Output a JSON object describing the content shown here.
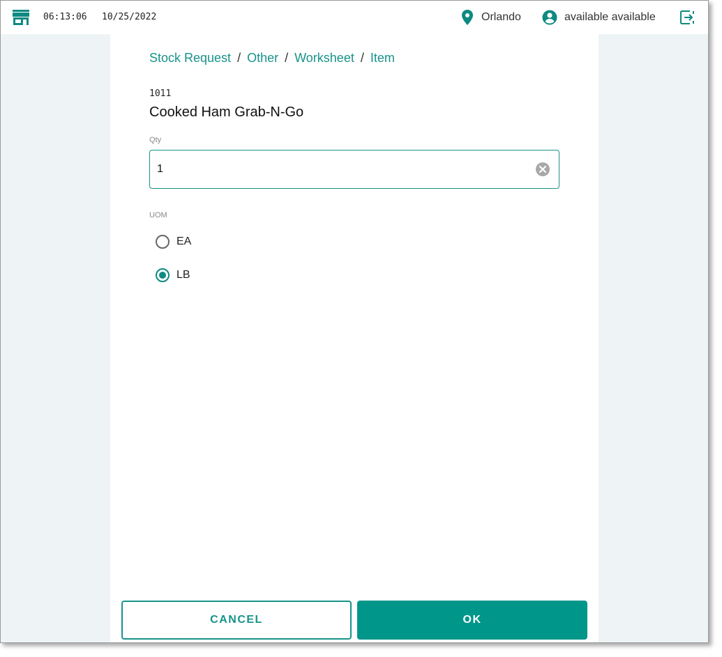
{
  "header": {
    "store_icon": "storefront-icon",
    "time": "06:13:06",
    "date": "10/25/2022",
    "location_icon": "map-pin-icon",
    "location": "Orlando",
    "user_icon": "account-circle-icon",
    "user": "available available",
    "logout_icon": "logout-icon"
  },
  "breadcrumb": {
    "items": [
      "Stock Request",
      "Other",
      "Worksheet",
      "Item"
    ],
    "separator": "/"
  },
  "item": {
    "code": "1011",
    "name": "Cooked Ham Grab-N-Go"
  },
  "qty": {
    "label": "Qty",
    "value": "1",
    "clear_icon": "clear-circle-icon"
  },
  "uom": {
    "label": "UOM",
    "options": [
      {
        "label": "EA",
        "selected": false
      },
      {
        "label": "LB",
        "selected": true
      }
    ]
  },
  "actions": {
    "cancel_label": "CANCEL",
    "ok_label": "OK"
  },
  "colors": {
    "accent": "#17938a",
    "primary_button": "#00968a",
    "background": "#eef3f5"
  }
}
